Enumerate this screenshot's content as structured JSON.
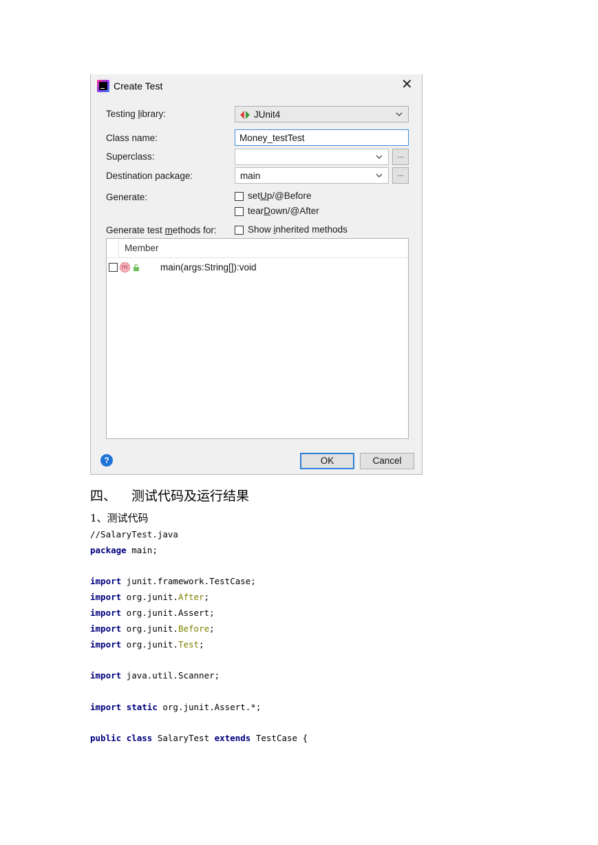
{
  "dialog": {
    "title": "Create Test",
    "close_icon": "close-icon",
    "testing_library": {
      "label_pre": "Testing ",
      "label_u": "l",
      "label_post": "ibrary:",
      "value": "JUnit4"
    },
    "class_name": {
      "label": "Class name:",
      "value": "Money_testTest"
    },
    "superclass": {
      "label": "Superclass:",
      "value": "",
      "browse": "..."
    },
    "destination_package": {
      "label": "Destination package:",
      "value": "main",
      "browse": "..."
    },
    "generate": {
      "label": "Generate:",
      "setup": {
        "pre": "set",
        "u": "U",
        "post": "p/@Before",
        "checked": false
      },
      "teardown": {
        "pre": "tear",
        "u": "D",
        "post": "own/@After",
        "checked": false
      }
    },
    "generate_methods": {
      "label_pre": "Generate test ",
      "label_u": "m",
      "label_post": "ethods for:",
      "show_inherited": {
        "pre": "Show ",
        "u": "i",
        "post": "nherited methods",
        "checked": false
      }
    },
    "table": {
      "header": "Member",
      "rows": [
        {
          "checked": false,
          "icon": "m",
          "method": "main(args:String[]):void"
        }
      ]
    },
    "help_icon": "?",
    "ok_label": "OK",
    "cancel_label": "Cancel"
  },
  "document": {
    "heading_number": "四、",
    "heading_text": "测试代码及运行结果",
    "subheading": "1、测试代码",
    "code": {
      "comment": "//SalaryTest.java",
      "package_kw": "package",
      "package_rest": " main;",
      "imports": [
        {
          "kw": "import",
          "pre": " junit.framework.TestCase;",
          "ann": "",
          "post": ""
        },
        {
          "kw": "import",
          "pre": " org.junit.",
          "ann": "After",
          "post": ";"
        },
        {
          "kw": "import",
          "pre": " org.junit.Assert;",
          "ann": "",
          "post": ""
        },
        {
          "kw": "import",
          "pre": " org.junit.",
          "ann": "Before",
          "post": ";"
        },
        {
          "kw": "import",
          "pre": " org.junit.",
          "ann": "Test",
          "post": ";"
        }
      ],
      "scanner_kw": "import",
      "scanner_rest": " java.util.Scanner;",
      "static_kw1": "import",
      "static_kw2": "static",
      "static_rest": " org.junit.Assert.*;",
      "class_kw1": "public",
      "class_kw2": "class",
      "class_name": " SalaryTest ",
      "class_kw3": "extends",
      "class_rest": " TestCase {"
    }
  }
}
